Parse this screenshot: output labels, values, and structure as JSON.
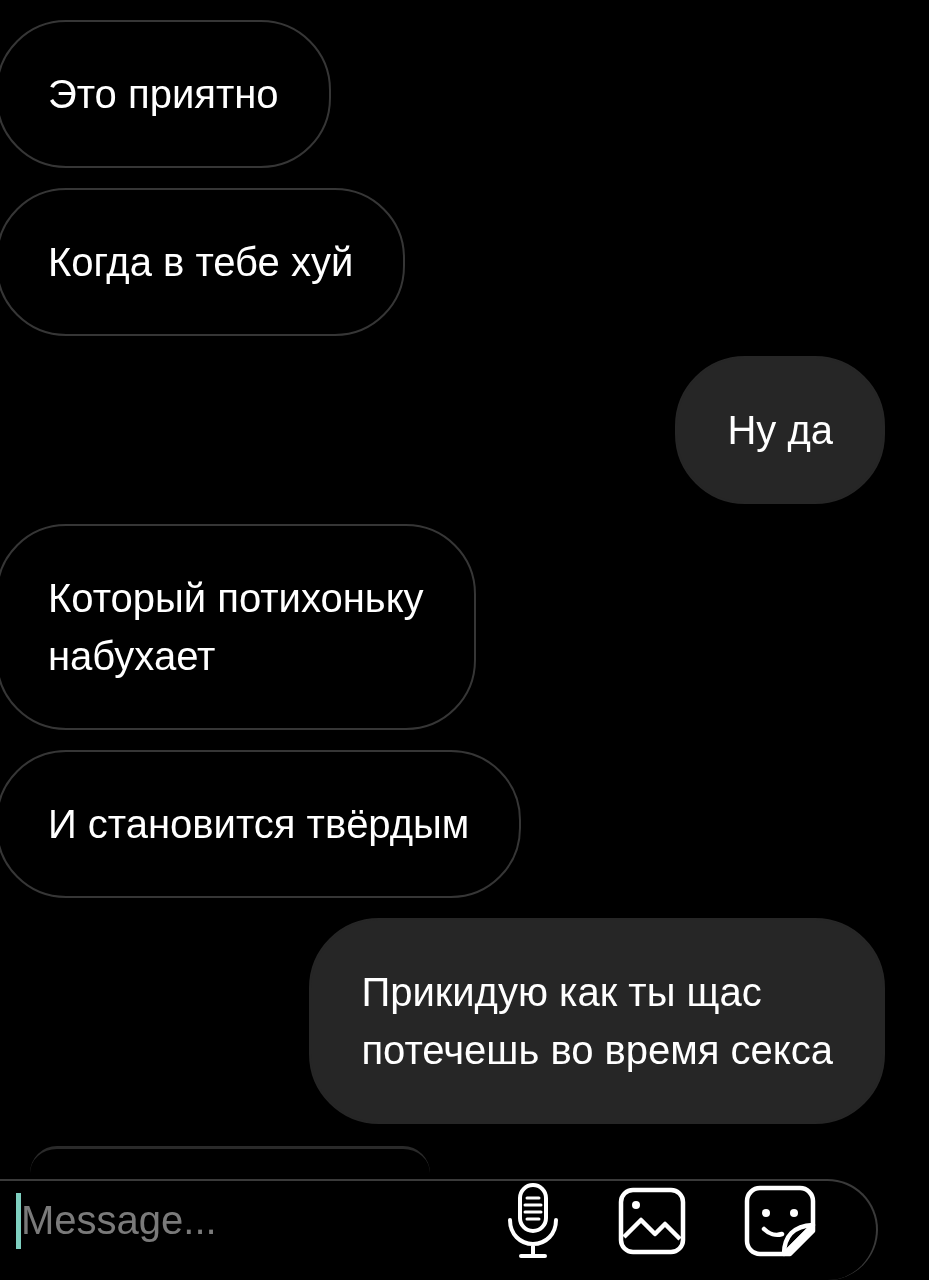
{
  "messages": [
    {
      "kind": "incoming",
      "text": "Это приятно"
    },
    {
      "kind": "incoming",
      "text": "Когда в тебе хуй"
    },
    {
      "kind": "outgoing",
      "text": "Ну да"
    },
    {
      "kind": "incoming",
      "text": "Который потихоньку\nнабухает"
    },
    {
      "kind": "incoming",
      "text": "И становится твёрдым"
    },
    {
      "kind": "outgoing",
      "text": "Прикидую как ты щас\nпотечешь во время секса"
    }
  ],
  "composer": {
    "placeholder": "Message..."
  }
}
